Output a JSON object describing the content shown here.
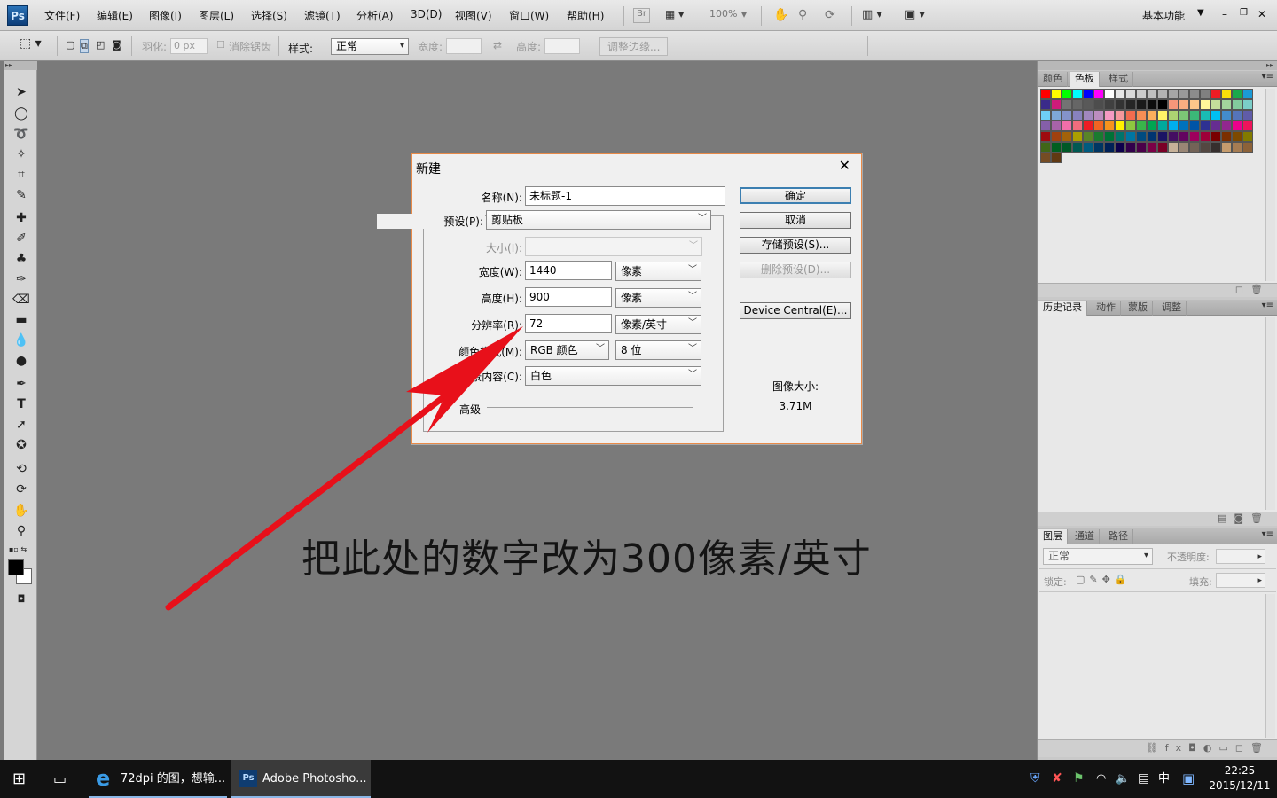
{
  "app": {
    "logo": "Ps",
    "menu": [
      "文件(F)",
      "编辑(E)",
      "图像(I)",
      "图层(L)",
      "选择(S)",
      "滤镜(T)",
      "分析(A)",
      "3D(D)",
      "视图(V)",
      "窗口(W)",
      "帮助(H)"
    ],
    "zoom": "100%",
    "workspace": "基本功能",
    "br_label": "Br"
  },
  "options": {
    "feather_label": "羽化:",
    "feather_value": "0 px",
    "antialias_label": "消除锯齿",
    "style_label": "样式:",
    "style_value": "正常",
    "width_label": "宽度:",
    "height_label": "高度:",
    "refine_label": "调整边缘..."
  },
  "panels": {
    "color_tabs": [
      "颜色",
      "色板",
      "样式"
    ],
    "history_tabs": [
      "历史记录",
      "动作",
      "蒙版",
      "调整"
    ],
    "layers_tabs": [
      "图层",
      "通道",
      "路径"
    ],
    "blend_mode": "正常",
    "opacity_label": "不透明度:",
    "lock_label": "锁定:",
    "fill_label": "填充:"
  },
  "swatches": [
    "#ff0000",
    "#ffff00",
    "#00ff00",
    "#00ffff",
    "#0000ff",
    "#ff00ff",
    "#ffffff",
    "#e6e6e6",
    "#d9d9d9",
    "#cccccc",
    "#bfbfbf",
    "#b3b3b3",
    "#a6a6a6",
    "#999999",
    "#8c8c8c",
    "#808080",
    "#ee1c24",
    "#f7e00b",
    "#1aa84b",
    "#1c9ad6",
    "#3a2b8a",
    "#cf1b7a",
    "#737373",
    "#666666",
    "#595959",
    "#4d4d4d",
    "#404040",
    "#333333",
    "#262626",
    "#1a1a1a",
    "#0d0d0d",
    "#000000",
    "#f7977a",
    "#f9ad81",
    "#fdc68a",
    "#fff79a",
    "#c4df9b",
    "#a3d39c",
    "#82ca9d",
    "#7bcdc8",
    "#6ecff6",
    "#7ea7d8",
    "#8493ca",
    "#8882be",
    "#a187be",
    "#bc8dbf",
    "#f49ac2",
    "#f6989d",
    "#f26c4f",
    "#f68e55",
    "#fbaf5c",
    "#fff467",
    "#acd372",
    "#7cc576",
    "#3bb878",
    "#1abbb4",
    "#00bff3",
    "#438ccb",
    "#5574b9",
    "#605ca8",
    "#855fa8",
    "#a763a8",
    "#f06ea9",
    "#f26d7d",
    "#ed1c24",
    "#f26522",
    "#f7941d",
    "#fff200",
    "#8dc73f",
    "#39b54a",
    "#00a651",
    "#00a99d",
    "#00aeef",
    "#0072bc",
    "#0054a6",
    "#2e3192",
    "#662d91",
    "#92278f",
    "#ec008c",
    "#ed145b",
    "#9e0b0f",
    "#a0410d",
    "#a36209",
    "#aba000",
    "#598527",
    "#1a7b30",
    "#007236",
    "#00746b",
    "#0076a3",
    "#004b80",
    "#003471",
    "#1b1464",
    "#440e62",
    "#630460",
    "#9e005d",
    "#9e0039",
    "#790000",
    "#7b2e00",
    "#7d4900",
    "#827b00",
    "#406618",
    "#005e20",
    "#005826",
    "#005952",
    "#005b7f",
    "#003663",
    "#002157",
    "#0d004c",
    "#32004b",
    "#4b0049",
    "#7b0046",
    "#7a0026",
    "#c7b299",
    "#998675",
    "#736357",
    "#534741",
    "#362f2d",
    "#c69c6d",
    "#a67c52",
    "#8c6239",
    "#754c24",
    "#603913"
  ],
  "dialog": {
    "title": "新建",
    "name_label": "名称(N):",
    "name_value": "未标题-1",
    "preset_label": "预设(P):",
    "preset_value": "剪贴板",
    "size_label": "大小(I):",
    "width_label": "宽度(W):",
    "width_value": "1440",
    "width_unit": "像素",
    "height_label": "高度(H):",
    "height_value": "900",
    "height_unit": "像素",
    "res_label": "分辨率(R):",
    "res_value": "72",
    "res_unit": "像素/英寸",
    "mode_label": "颜色模式(M):",
    "mode_value": "RGB 颜色",
    "depth_value": "8 位",
    "bg_label": "背景内容(C):",
    "bg_value": "白色",
    "advanced_label": "高级",
    "ok": "确定",
    "cancel": "取消",
    "save_preset": "存储预设(S)...",
    "delete_preset": "删除预设(D)...",
    "device_central": "Device Central(E)...",
    "image_size_label": "图像大小:",
    "image_size_value": "3.71M"
  },
  "annotation": "把此处的数字改为300像素/英寸",
  "taskbar": {
    "ie_label": "72dpi 的图，想输...",
    "ps_label": "Adobe Photosho...",
    "time": "22:25",
    "date": "2015/12/11",
    "ime": "中"
  },
  "colors": {
    "accent": "#e8101a",
    "dialog_border": "#e88a48"
  }
}
